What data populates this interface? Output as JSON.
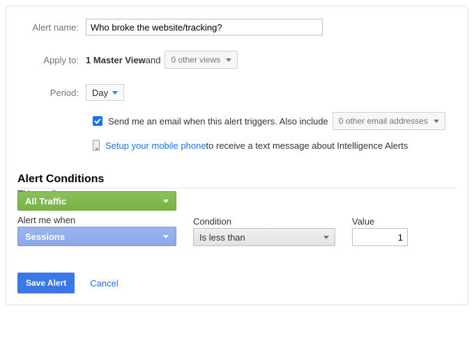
{
  "form": {
    "alert_name_label": "Alert name:",
    "alert_name_value": "Who broke the website/tracking?",
    "apply_to_label": "Apply to:",
    "apply_selected_view": "1 Master View",
    "apply_and": " and",
    "other_views_dd": "0 other views",
    "period_label": "Period:",
    "period_value": "Day",
    "email_checkbox_label": "Send me an email when this alert triggers. Also include",
    "other_emails_dd": "0 other email addresses",
    "phone_link": "Setup your mobile phone",
    "phone_rest": " to receive a text message about Intelligence Alerts"
  },
  "conditions": {
    "title": "Alert Conditions",
    "applies_label": "This applies to",
    "applies_value": "All Traffic",
    "alert_when_label": "Alert me when",
    "alert_when_value": "Sessions",
    "condition_label": "Condition",
    "condition_value": "Is less than",
    "value_label": "Value",
    "value_value": "1"
  },
  "actions": {
    "save": "Save Alert",
    "cancel": "Cancel"
  }
}
